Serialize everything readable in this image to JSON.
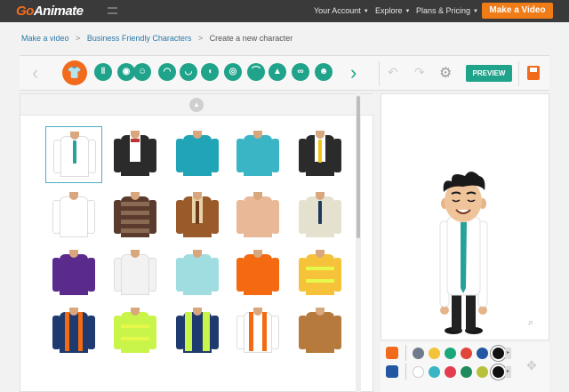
{
  "nav": {
    "logo_prefix": "Go",
    "logo_suffix": "Animate",
    "links": [
      {
        "label": "Your Account"
      },
      {
        "label": "Explore"
      },
      {
        "label": "Plans & Pricing"
      }
    ],
    "cta_label": "Make a Video"
  },
  "breadcrumb": {
    "items": [
      "Make a video",
      "Business Friendly Characters"
    ],
    "current": "Create a new character"
  },
  "toolbar": {
    "categories": [
      {
        "icon": "shirt-icon",
        "glyph": "👕",
        "active": true
      },
      {
        "icon": "pants-icon",
        "glyph": "ǁ"
      },
      {
        "icon": "shoes-icon",
        "glyph": "◉"
      },
      {
        "icon": "face-shape-icon",
        "glyph": "☺"
      },
      {
        "icon": "hair-icon",
        "glyph": "◠"
      },
      {
        "icon": "mouth-icon",
        "glyph": "◡"
      },
      {
        "icon": "ear-icon",
        "glyph": "◖"
      },
      {
        "icon": "eyes-icon",
        "glyph": "◎"
      },
      {
        "icon": "eyebrows-icon",
        "glyph": "⌒"
      },
      {
        "icon": "nose-icon",
        "glyph": "▲"
      },
      {
        "icon": "glasses-icon",
        "glyph": "∞"
      },
      {
        "icon": "beard-icon",
        "glyph": "☻"
      }
    ],
    "preview_label": "PREVIEW"
  },
  "grid": {
    "items": [
      {
        "body": "#ffffff",
        "tie": "#2aa198",
        "selected": true
      },
      {
        "body": "#2b2b2b",
        "shirt": "#ffffff",
        "bow": true
      },
      {
        "body": "#21a4b5"
      },
      {
        "body": "#3ab5c6"
      },
      {
        "body": "#2b2b2b",
        "shirt": "#ffffff",
        "tie": "#f0c419"
      },
      {
        "body": "#ffffff"
      },
      {
        "body": "#5a3b2e",
        "stripes": "#8a6a52"
      },
      {
        "body": "#9a5a2a",
        "shirt": "#e9d2a8",
        "tie": "#6b3a1a"
      },
      {
        "body": "#e9b896"
      },
      {
        "body": "#e4e2cf",
        "tie": "#1f3a5a"
      },
      {
        "body": "#5a2a8c"
      },
      {
        "body": "#f2f2f2"
      },
      {
        "body": "#9fdde0"
      },
      {
        "body": "#f46a10"
      },
      {
        "body": "#f5c23a",
        "bands": true
      },
      {
        "body": "#1f3a6e",
        "straps": "#f46a10"
      },
      {
        "body": "#c9f54a",
        "bands": true
      },
      {
        "body": "#1f3a6e",
        "vest": "#c9f54a"
      },
      {
        "body": "#ffffff",
        "straps": "#f46a10"
      },
      {
        "body": "#b57a3c"
      }
    ]
  },
  "palette": {
    "rows": [
      {
        "icon": "shirt-color-icon",
        "icon_color": "#f26b1d",
        "colors": [
          "#6f7b8a",
          "#f3c33a",
          "#1aa779",
          "#e0453a",
          "#2457a2",
          "#111111"
        ]
      },
      {
        "icon": "tie-color-icon",
        "icon_color": "#2457a2",
        "colors": [
          "#ffffff",
          "#3ab5c6",
          "#e33d4e",
          "#1f8a5b",
          "#b8c13a",
          "#111111"
        ]
      }
    ]
  }
}
